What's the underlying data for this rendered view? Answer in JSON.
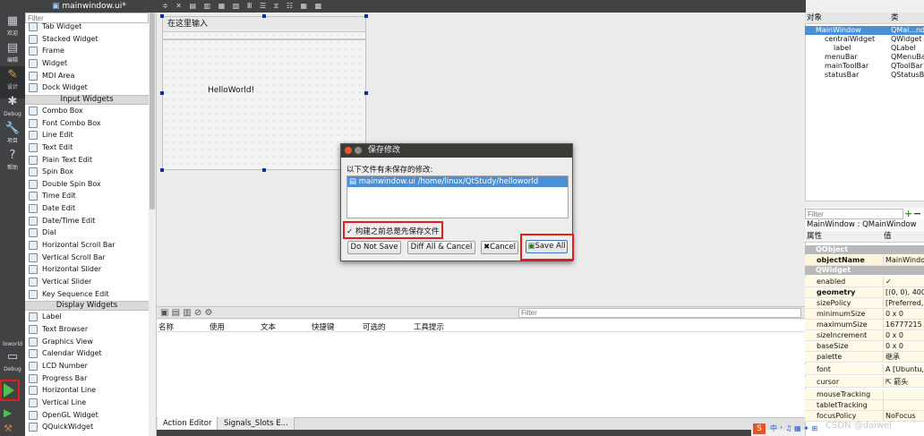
{
  "window": {
    "file_tab": "mainwindow.ui*"
  },
  "modes": [
    {
      "label": "欢迎",
      "icon": "grid-icon"
    },
    {
      "label": "编辑",
      "icon": "edit-icon"
    },
    {
      "label": "设计",
      "icon": "design-icon"
    },
    {
      "label": "Debug",
      "icon": "bug-icon"
    },
    {
      "label": "项目",
      "icon": "wrench-icon"
    },
    {
      "label": "帮助",
      "icon": "help-icon"
    }
  ],
  "kit": {
    "project": "loworld",
    "config": "Debug"
  },
  "widgetbox": {
    "filter_placeholder": "Filter",
    "items_top": [
      "Tab Widget",
      "Stacked Widget",
      "Frame",
      "Widget",
      "MDI Area",
      "Dock Widget"
    ],
    "cat_input": "Input Widgets",
    "items_input": [
      "Combo Box",
      "Font Combo Box",
      "Line Edit",
      "Text Edit",
      "Plain Text Edit",
      "Spin Box",
      "Double Spin Box",
      "Time Edit",
      "Date Edit",
      "Date/Time Edit",
      "Dial",
      "Horizontal Scroll Bar",
      "Vertical Scroll Bar",
      "Horizontal Slider",
      "Vertical Slider",
      "Key Sequence Edit"
    ],
    "cat_display": "Display Widgets",
    "items_display": [
      "Label",
      "Text Browser",
      "Graphics View",
      "Calendar Widget",
      "LCD Number",
      "Progress Bar",
      "Horizontal Line",
      "Vertical Line",
      "OpenGL Widget",
      "QQuickWidget"
    ]
  },
  "form": {
    "menu_placeholder": "在这里输入",
    "label_text": "HelloWorld!"
  },
  "action_editor": {
    "filter_placeholder": "Filter",
    "columns": [
      "名称",
      "使用",
      "文本",
      "快捷键",
      "可选的",
      "工具提示"
    ],
    "tabs": [
      "Action Editor",
      "Signals_Slots E..."
    ]
  },
  "object_inspector": {
    "headers": [
      "对象",
      "类"
    ],
    "rows": [
      {
        "name": "MainWindow",
        "cls": "QMai...ndow"
      },
      {
        "name": "centralWidget",
        "cls": "QWidget"
      },
      {
        "name": "label",
        "cls": "QLabel"
      },
      {
        "name": "menuBar",
        "cls": "QMenuBar"
      },
      {
        "name": "mainToolBar",
        "cls": "QToolBar"
      },
      {
        "name": "statusBar",
        "cls": "QStatusBar"
      }
    ]
  },
  "property_editor": {
    "filter_placeholder": "Filter",
    "title": "MainWindow : QMainWindow",
    "headers": [
      "属性",
      "值"
    ],
    "cat_qobject": "QObject",
    "cat_qwidget": "QWidget",
    "rows": [
      {
        "name": "objectName",
        "value": "MainWindow"
      },
      {
        "name": "enabled",
        "value": "✓"
      },
      {
        "name": "geometry",
        "value": "[(0, 0), 400 x"
      },
      {
        "name": "sizePolicy",
        "value": "[Preferred, Pre"
      },
      {
        "name": "minimumSize",
        "value": "0 x 0"
      },
      {
        "name": "maximumSize",
        "value": "16777215 x 1"
      },
      {
        "name": "sizeIncrement",
        "value": "0 x 0"
      },
      {
        "name": "baseSize",
        "value": "0 x 0"
      },
      {
        "name": "palette",
        "value": "继承"
      },
      {
        "name": "font",
        "value": "A [Ubuntu, 11]"
      },
      {
        "name": "cursor",
        "value": "⇱ 箭头"
      },
      {
        "name": "mouseTracking",
        "value": ""
      },
      {
        "name": "tabletTracking",
        "value": ""
      },
      {
        "name": "focusPolicy",
        "value": "NoFocus"
      }
    ]
  },
  "dialog": {
    "title": "保存修改",
    "message": "以下文件有未保存的修改:",
    "file_entry": "mainwindow.ui  /home/linux/QtStudy/helloworld",
    "checkbox_label": "构建之前总是先保存文件",
    "btn_dont_save": "Do Not Save",
    "btn_diff_cancel": "Diff All & Cancel",
    "btn_cancel": "Cancel",
    "btn_save_all": "Save All"
  },
  "watermark": "CSDN @daiwei"
}
